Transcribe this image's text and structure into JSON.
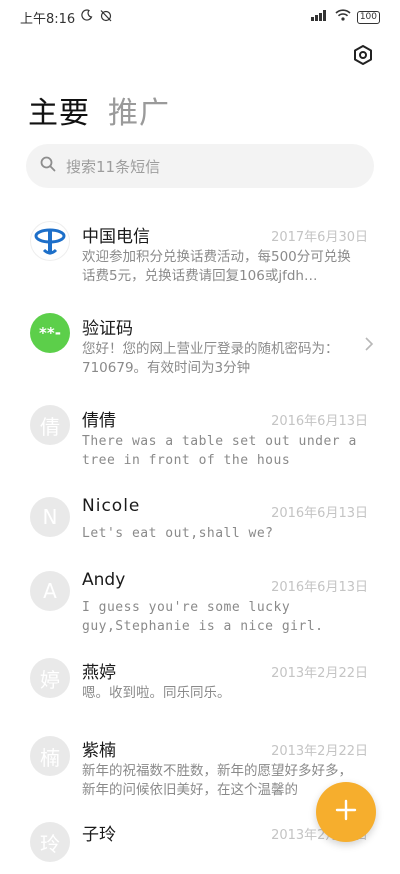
{
  "status": {
    "time": "上午8:16",
    "battery": "100"
  },
  "tabs": {
    "main": "主要",
    "promo": "推广"
  },
  "search": {
    "placeholder": "搜索11条短信"
  },
  "messages": [
    {
      "name": "中国电信",
      "date": "2017年6月30日",
      "preview": "欢迎参加积分兑换话费活动，每500分可兑换话费5元，兑换话费请回复106或jfdh…"
    },
    {
      "name": "验证码",
      "avatar": "**-",
      "preview": "您好！您的网上营业厅登录的随机密码为：710679。有效时间为3分钟"
    },
    {
      "name": "倩倩",
      "avatar": "倩",
      "date": "2016年6月13日",
      "preview": "There was a table set out under a tree in front of the hous"
    },
    {
      "name": "Nicole",
      "avatar": "N",
      "date": "2016年6月13日",
      "preview": "Let's eat out,shall we?"
    },
    {
      "name": "Andy",
      "avatar": "A",
      "date": "2016年6月13日",
      "preview": "I guess you're some lucky guy,Stephanie is a nice girl."
    },
    {
      "name": "燕婷",
      "avatar": "婷",
      "date": "2013年2月22日",
      "preview": "嗯。收到啦。同乐同乐。"
    },
    {
      "name": "紫楠",
      "avatar": "楠",
      "date": "2013年2月22日",
      "preview": "新年的祝福数不胜数，新年的愿望好多好多，新年的问候依旧美好，在这个温馨的"
    },
    {
      "name": "子玲",
      "avatar": "玲",
      "date": "2013年2月22日",
      "preview": ""
    }
  ]
}
